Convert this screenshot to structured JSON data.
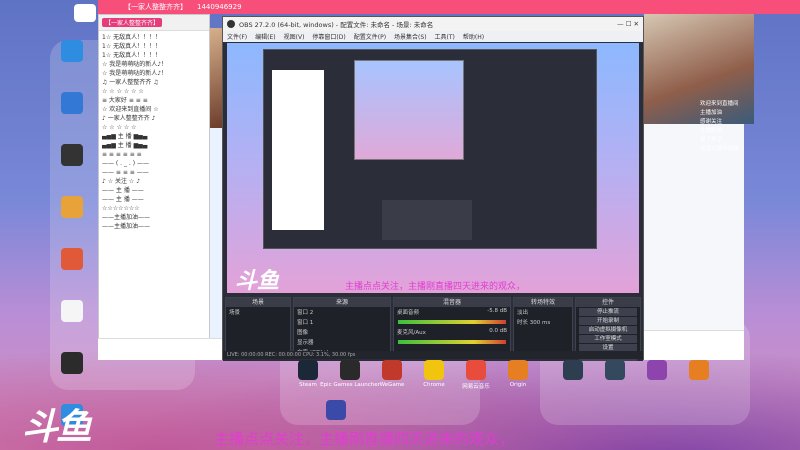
{
  "client_bar": {
    "live_label": "【一家人整整齐齐】",
    "id_text": "1440946929"
  },
  "desktop_icons": [
    {
      "label": "",
      "color": "#2e8de0"
    },
    {
      "label": "",
      "color": "#3478d6"
    },
    {
      "label": "",
      "color": "#333333"
    },
    {
      "label": "",
      "color": "#e8a23a"
    },
    {
      "label": "",
      "color": "#e05a3a"
    },
    {
      "label": "",
      "color": "#f5f5f5"
    },
    {
      "label": "",
      "color": "#2b2b2b"
    },
    {
      "label": "",
      "color": "#2e8de0"
    }
  ],
  "chat": {
    "title": "【一家人整整齐齐】",
    "lines": [
      "1☆ 无敌真人！！！！",
      "1☆ 无敌真人！！！！",
      "1☆ 无敌真人！！！！",
      "☆ 我是萌萌哒的新人♪！",
      "☆ 我是萌萌哒的新人♪！",
      "♫ 一家人整整齐齐 ♫",
      "☆ ☆ ☆ ☆ ☆ ☆",
      "≡ 大家好 ≡ ≡ ≡",
      "☆ 欢迎来到直播间 ☆",
      "♪ 一家人整整齐齐 ♪",
      "☆ ☆ ☆ ☆ ☆",
      "▄▅▆ 主 播 ▆▅▄",
      "▄▅▆ 主 播 ▆▅▄",
      "≡ ≡ ≡ ≡ ≡ ≡",
      "—— ( . _ . ) ——",
      "—— ≡ ≡ ≡ ——",
      "♪ ☆ 关注 ☆ ♪",
      "—— 主 播 ——",
      "—— 主 播 ——",
      "☆☆☆☆☆☆☆",
      "——主播加油——",
      "——主播加油——"
    ]
  },
  "obs": {
    "title": "OBS 27.2.0 (64-bit, windows) - 配置文件: 未命名 - 场景: 未命名",
    "menus": [
      "文件(F)",
      "编辑(E)",
      "视图(V)",
      "停靠窗口(D)",
      "配置文件(P)",
      "场景集合(S)",
      "工具(T)",
      "帮助(H)"
    ],
    "scroll_text_small": "主播点点关注，主播刚直播四天进来的观众，",
    "brand": "斗鱼",
    "docks": {
      "scenes": "场景",
      "sources": "来源",
      "mixer": "混音器",
      "transitions": "转场特效",
      "controls": "控件"
    },
    "scene_items": [
      "场景"
    ],
    "source_items": [
      "窗口 2",
      "窗口 1",
      "图像",
      "显示器",
      "文字 (GDI+)"
    ],
    "mixer_tracks": [
      {
        "name": "桌面音频",
        "db": "-5.8 dB"
      },
      {
        "name": "麦克风/Aux",
        "db": "0.0 dB"
      }
    ],
    "transition": {
      "type": "淡出",
      "duration_label": "时长",
      "duration": "300 ms"
    },
    "controls": [
      "停止推流",
      "开始录制",
      "启动虚拟摄像机",
      "工作室模式",
      "设置",
      "退出"
    ],
    "status": "LIVE: 00:00:00   REC: 00:00:00   CPU: 3.1%, 30.00 fps"
  },
  "right_chat": [
    "欢迎来到直播间",
    "主播加油",
    "感谢关注",
    "主播好帅",
    "来了来了",
    "关注主播不迷路"
  ],
  "dock_apps": [
    {
      "label": "Steam",
      "color": "#1b2838"
    },
    {
      "label": "Epic Games Launcher",
      "color": "#2a2a2a"
    },
    {
      "label": "WeGame",
      "color": "#c0392b"
    },
    {
      "label": "Chrome",
      "color": "#f1c40f"
    },
    {
      "label": "网易云音乐",
      "color": "#e74c3c"
    },
    {
      "label": "Origin",
      "color": "#e67e22"
    }
  ],
  "dock_right_apps": [
    {
      "label": "",
      "color": "#2c3e50"
    },
    {
      "label": "",
      "color": "#34495e"
    },
    {
      "label": "",
      "color": "#8e44ad"
    },
    {
      "label": "",
      "color": "#e67e22"
    }
  ],
  "desktop_extra": {
    "label": "",
    "color": "#3b4aa8"
  },
  "brand": "斗鱼",
  "scroll_text": "主播点点关注，主播刚直播四天进来的观众，"
}
